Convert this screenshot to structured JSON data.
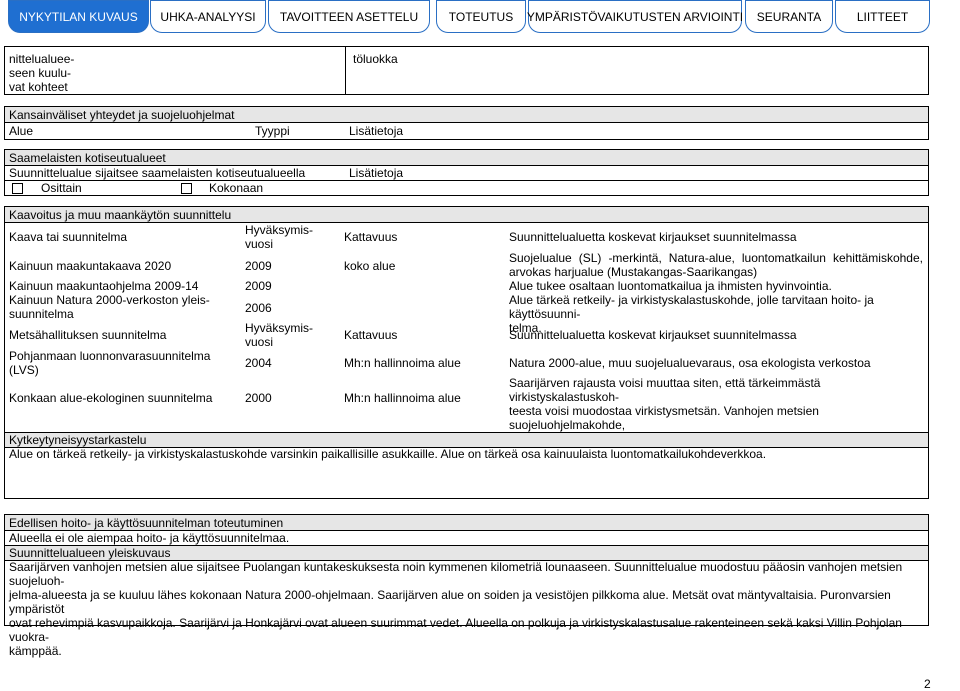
{
  "nav": {
    "tabs": [
      {
        "label": "NYKYTILAN KUVAUS",
        "active": true
      },
      {
        "label": "UHKA-ANALYYSI",
        "active": false
      },
      {
        "label": "TAVOITTEEN ASETTELU",
        "active": false
      },
      {
        "label": "TOTEUTUS",
        "active": false
      },
      {
        "label": "YMPÄRISTÖVAIKUTUSTEN ARVIOINTI",
        "active": false
      },
      {
        "label": "SEURANTA",
        "active": false
      },
      {
        "label": "LIITTEET",
        "active": false
      }
    ],
    "accent": "#1f6fd1"
  },
  "section1": {
    "left_label": "nittelualuee-\nseen kuulu-\nvat kohteet",
    "right_label": "töluokka"
  },
  "intl": {
    "title": "Kansainväliset yhteydet ja suojeluohjelmat",
    "col_alue": "Alue",
    "col_tyyppi": "Tyyppi",
    "col_lisatietoja": "Lisätietoja"
  },
  "sami": {
    "title": "Saamelaisten kotiseutualueet",
    "subtitle": "Suunnittelualue sijaitsee saamelaisten kotiseutualueella",
    "lisatietoja": "Lisätietoja",
    "option_osittain": "Osittain",
    "option_kokonaan": "Kokonaan"
  },
  "kaavoitus": {
    "title": "Kaavoitus ja muu maankäytön suunnittelu",
    "head": {
      "c1": "Kaava tai suunnitelma",
      "c2": "Hyväksymis-\nvuosi",
      "c3": "Kattavuus",
      "c4": "Suunnittelualuetta koskevat kirjaukset suunnitelmassa"
    },
    "row1": {
      "c1": "Kainuun maakuntakaava 2020",
      "c2": "2009",
      "c3": "koko alue",
      "c4": "Suojelualue (SL) -merkintä, Natura-alue, luontomatkailun kehittämiskohde, arvokas harjualue (Mustakangas-Saarikangas)"
    },
    "row2": {
      "c1": "Kainuun maakuntaohjelma 2009-14",
      "c2": "2009",
      "c3": "",
      "c4": "Alue tukee osaltaan luontomatkailua ja ihmisten hyvinvointia."
    },
    "row3": {
      "c1": "Kainuun Natura 2000-verkoston yleis-\nsuunnitelma",
      "c2": "2006",
      "c3": "",
      "c4": "Alue tärkeä retkeily- ja virkistyskalastuskohde, jolle tarvitaan hoito- ja käyttösuunni-\ntelma."
    },
    "head2": {
      "c1": "Metsähallituksen suunnitelma",
      "c2": "Hyväksymis-\nvuosi",
      "c3": "Kattavuus",
      "c4": "Suunnittelualuetta koskevat kirjaukset suunnitelmassa"
    },
    "row4": {
      "c1": "Pohjanmaan luonnonvarasuunnitelma\n(LVS)",
      "c2": "2004",
      "c3": "Mh:n hallinnoima alue",
      "c4": "Natura 2000-alue, muu suojelualuevaraus, osa ekologista verkostoa"
    },
    "row5": {
      "c1": "Konkaan alue-ekologinen suunnitelma",
      "c2": "2000",
      "c3": "Mh:n hallinnoima alue",
      "c4": "Saarijärven rajausta voisi muuttaa siten, että tärkeimmästä virkistyskalastuskoh-\nteesta voisi muodostaa virkistysmetsän. Vanhojen metsien suojeluohjelmakohde,\nNatura 2000-alue"
    }
  },
  "kytkeytyneisyys": {
    "title": "Kytkeytyneisyystarkastelu",
    "text": "Alue on tärkeä retkeily- ja virkistyskalastuskohde varsinkin paikallisille asukkaille. Alue on tärkeä osa kainuulaista luontomatkailukohdeverkkoa."
  },
  "edelliset": {
    "title": "Edellisen hoito- ja käyttösuunnitelman toteutuminen",
    "text": "Alueella ei ole aiempaa hoito- ja käyttösuunnitelmaa.",
    "title2": "Suunnittelualueen yleiskuvaus",
    "text2": "Saarijärven vanhojen metsien alue sijaitsee Puolangan kuntakeskuksesta noin kymmenen kilometriä lounaaseen. Suunnittelualue muodostuu pääosin vanhojen metsien suojeluoh-\njelma-alueesta ja se kuuluu lähes kokonaan Natura 2000-ohjelmaan. Saarijärven alue on soiden ja vesistöjen pilkkoma alue. Metsät ovat mäntyvaltaisia. Puronvarsien ympäristöt\novat rehevimpiä kasvupaikkoja. Saarijärvi ja Honkajärvi ovat alueen suurimmat vedet. Alueella on polkuja ja virkistyskalastusalue rakenteineen sekä kaksi Villin Pohjolan vuokra-\nkämppää."
  },
  "page_number": "2"
}
